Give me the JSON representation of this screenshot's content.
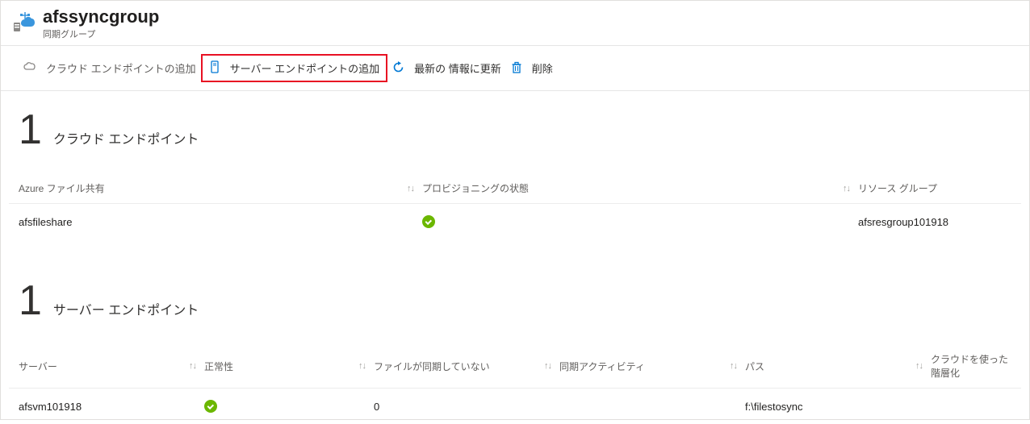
{
  "header": {
    "title": "afssyncgroup",
    "subtitle": "同期グループ"
  },
  "toolbar": {
    "add_cloud_endpoint": "クラウド エンドポイントの追加",
    "add_server_endpoint": "サーバー エンドポイントの追加",
    "refresh": "最新の 情報に更新",
    "delete": "削除"
  },
  "cloud_section": {
    "count": "1",
    "title": "クラウド エンドポイント",
    "columns": {
      "azure_file_share": "Azure ファイル共有",
      "provisioning_state": "プロビジョニングの状態",
      "resource_group": "リソース グループ"
    },
    "row": {
      "share": "afsfileshare",
      "resource_group": "afsresgroup101918"
    }
  },
  "server_section": {
    "count": "1",
    "title": "サーバー エンドポイント",
    "columns": {
      "server": "サーバー",
      "health": "正常性",
      "files_not_syncing": "ファイルが同期していない",
      "sync_activity": "同期アクティビティ",
      "path": "パス",
      "cloud_tiering": "クラウドを使った階層化"
    },
    "row": {
      "server": "afsvm101918",
      "files_not_syncing": "0",
      "sync_activity": "",
      "path": "f:\\filestosync",
      "cloud_tiering": ""
    }
  }
}
